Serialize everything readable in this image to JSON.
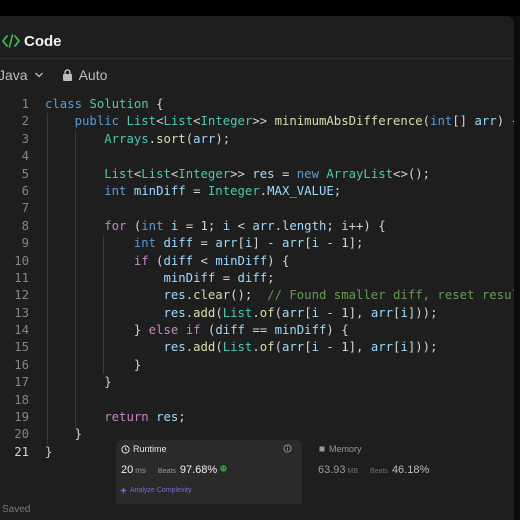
{
  "header": {
    "title": "Code",
    "icon": "code-icon"
  },
  "toolbar": {
    "language": "Java",
    "mode": "Auto"
  },
  "editor": {
    "active_line": 21,
    "lines": [
      [
        [
          "k",
          "class"
        ],
        [
          "p",
          " "
        ],
        [
          "t",
          "Solution"
        ],
        [
          "p",
          " {"
        ]
      ],
      [
        [
          "p",
          "    "
        ],
        [
          "k",
          "public"
        ],
        [
          "p",
          " "
        ],
        [
          "t",
          "List"
        ],
        [
          "p",
          "<"
        ],
        [
          "t",
          "List"
        ],
        [
          "p",
          "<"
        ],
        [
          "t",
          "Integer"
        ],
        [
          "p",
          ">> "
        ],
        [
          "f",
          "minimumAbsDifference"
        ],
        [
          "p",
          "("
        ],
        [
          "k",
          "int"
        ],
        [
          "p",
          "[] "
        ],
        [
          "v",
          "arr"
        ],
        [
          "p",
          ") {"
        ]
      ],
      [
        [
          "p",
          "        "
        ],
        [
          "t",
          "Arrays"
        ],
        [
          "p",
          "."
        ],
        [
          "f",
          "sort"
        ],
        [
          "p",
          "("
        ],
        [
          "v",
          "arr"
        ],
        [
          "p",
          ");"
        ]
      ],
      [],
      [
        [
          "p",
          "        "
        ],
        [
          "t",
          "List"
        ],
        [
          "p",
          "<"
        ],
        [
          "t",
          "List"
        ],
        [
          "p",
          "<"
        ],
        [
          "t",
          "Integer"
        ],
        [
          "p",
          ">> "
        ],
        [
          "v",
          "res"
        ],
        [
          "p",
          " = "
        ],
        [
          "k",
          "new"
        ],
        [
          "p",
          " "
        ],
        [
          "t",
          "ArrayList"
        ],
        [
          "p",
          "<>();"
        ]
      ],
      [
        [
          "p",
          "        "
        ],
        [
          "k",
          "int"
        ],
        [
          "p",
          " "
        ],
        [
          "v",
          "minDiff"
        ],
        [
          "p",
          " = "
        ],
        [
          "t",
          "Integer"
        ],
        [
          "p",
          "."
        ],
        [
          "v",
          "MAX_VALUE"
        ],
        [
          "p",
          ";"
        ]
      ],
      [],
      [
        [
          "p",
          "        "
        ],
        [
          "kc",
          "for"
        ],
        [
          "p",
          " ("
        ],
        [
          "k",
          "int"
        ],
        [
          "p",
          " "
        ],
        [
          "v",
          "i"
        ],
        [
          "p",
          " = 1; "
        ],
        [
          "v",
          "i"
        ],
        [
          "p",
          " < "
        ],
        [
          "v",
          "arr"
        ],
        [
          "p",
          "."
        ],
        [
          "v",
          "length"
        ],
        [
          "p",
          "; "
        ],
        [
          "v",
          "i"
        ],
        [
          "p",
          "++) {"
        ]
      ],
      [
        [
          "p",
          "            "
        ],
        [
          "k",
          "int"
        ],
        [
          "p",
          " "
        ],
        [
          "v",
          "diff"
        ],
        [
          "p",
          " = "
        ],
        [
          "v",
          "arr"
        ],
        [
          "p",
          "["
        ],
        [
          "v",
          "i"
        ],
        [
          "p",
          "] - "
        ],
        [
          "v",
          "arr"
        ],
        [
          "p",
          "["
        ],
        [
          "v",
          "i"
        ],
        [
          "p",
          " - 1];"
        ]
      ],
      [
        [
          "p",
          "            "
        ],
        [
          "kc",
          "if"
        ],
        [
          "p",
          " ("
        ],
        [
          "v",
          "diff"
        ],
        [
          "p",
          " < "
        ],
        [
          "v",
          "minDiff"
        ],
        [
          "p",
          ") {"
        ]
      ],
      [
        [
          "p",
          "                "
        ],
        [
          "v",
          "minDiff"
        ],
        [
          "p",
          " = "
        ],
        [
          "v",
          "diff"
        ],
        [
          "p",
          ";"
        ]
      ],
      [
        [
          "p",
          "                "
        ],
        [
          "v",
          "res"
        ],
        [
          "p",
          "."
        ],
        [
          "f",
          "clear"
        ],
        [
          "p",
          "();  "
        ],
        [
          "c",
          "// Found smaller diff, reset results"
        ]
      ],
      [
        [
          "p",
          "                "
        ],
        [
          "v",
          "res"
        ],
        [
          "p",
          "."
        ],
        [
          "f",
          "add"
        ],
        [
          "p",
          "("
        ],
        [
          "t",
          "List"
        ],
        [
          "p",
          "."
        ],
        [
          "f",
          "of"
        ],
        [
          "p",
          "("
        ],
        [
          "v",
          "arr"
        ],
        [
          "p",
          "["
        ],
        [
          "v",
          "i"
        ],
        [
          "p",
          " - 1], "
        ],
        [
          "v",
          "arr"
        ],
        [
          "p",
          "["
        ],
        [
          "v",
          "i"
        ],
        [
          "p",
          "]));"
        ]
      ],
      [
        [
          "p",
          "            } "
        ],
        [
          "kc",
          "else"
        ],
        [
          "p",
          " "
        ],
        [
          "kc",
          "if"
        ],
        [
          "p",
          " ("
        ],
        [
          "v",
          "diff"
        ],
        [
          "p",
          " == "
        ],
        [
          "v",
          "minDiff"
        ],
        [
          "p",
          ") {"
        ]
      ],
      [
        [
          "p",
          "                "
        ],
        [
          "v",
          "res"
        ],
        [
          "p",
          "."
        ],
        [
          "f",
          "add"
        ],
        [
          "p",
          "("
        ],
        [
          "t",
          "List"
        ],
        [
          "p",
          "."
        ],
        [
          "f",
          "of"
        ],
        [
          "p",
          "("
        ],
        [
          "v",
          "arr"
        ],
        [
          "p",
          "["
        ],
        [
          "v",
          "i"
        ],
        [
          "p",
          " - 1], "
        ],
        [
          "v",
          "arr"
        ],
        [
          "p",
          "["
        ],
        [
          "v",
          "i"
        ],
        [
          "p",
          "]));"
        ]
      ],
      [
        [
          "p",
          "            }"
        ]
      ],
      [
        [
          "p",
          "        }"
        ]
      ],
      [],
      [
        [
          "p",
          "        "
        ],
        [
          "kc",
          "return"
        ],
        [
          "p",
          " "
        ],
        [
          "v",
          "res"
        ],
        [
          "p",
          ";"
        ]
      ],
      [
        [
          "p",
          "    }"
        ]
      ],
      [
        [
          "p",
          "}"
        ]
      ]
    ]
  },
  "runtime": {
    "label": "Runtime",
    "value": "20",
    "unit": "ms",
    "beats_label": "Beats",
    "beats": "97.68%",
    "analyze": "Analyze Complexity"
  },
  "memory": {
    "label": "Memory",
    "value": "63.93",
    "unit": "MB",
    "beats_label": "Beats",
    "beats": "46.18%"
  },
  "status": {
    "saved": "Saved"
  }
}
